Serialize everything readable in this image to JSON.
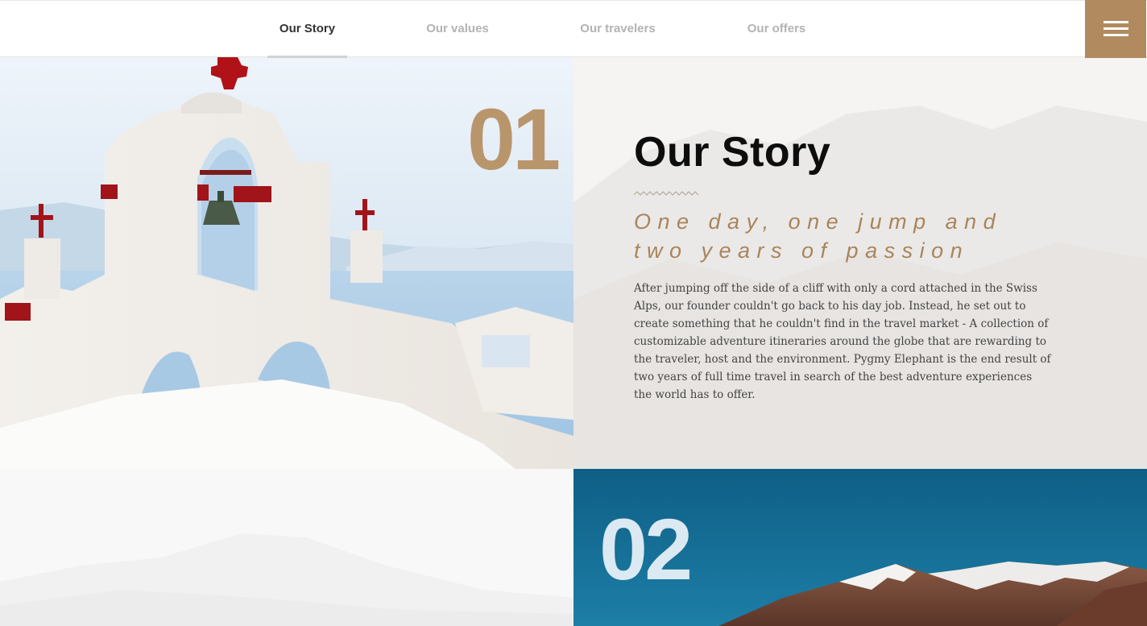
{
  "nav": {
    "tabs": [
      {
        "label": "Our Story",
        "active": true
      },
      {
        "label": "Our values",
        "active": false
      },
      {
        "label": "Our travelers",
        "active": false
      },
      {
        "label": "Our offers",
        "active": false
      }
    ],
    "menu_icon": "hamburger-menu-icon"
  },
  "sections": {
    "story": {
      "number": "01",
      "title": "Our Story",
      "subtitle": "One day, one jump and two years of passion",
      "body": "After jumping off the side of a cliff with only a cord attached in the Swiss Alps, our founder couldn't go back to his day job. Instead, he set out to create something that he couldn't find in the travel market - A collection of customizable adventure itineraries around the globe that are rewarding to the traveler, host and the environment. Pygmy Elephant is the end result of two years of full time travel in search of the best adventure experiences the world has to offer."
    },
    "second": {
      "number": "02"
    }
  },
  "colors": {
    "accent": "#b28a5f",
    "subtitle": "#a8855c",
    "title": "#0d0d0d",
    "body_text": "#444444",
    "nav_active": "#333333",
    "nav_inactive": "#b3b3b3",
    "mountain_sky": "#0f6489"
  }
}
